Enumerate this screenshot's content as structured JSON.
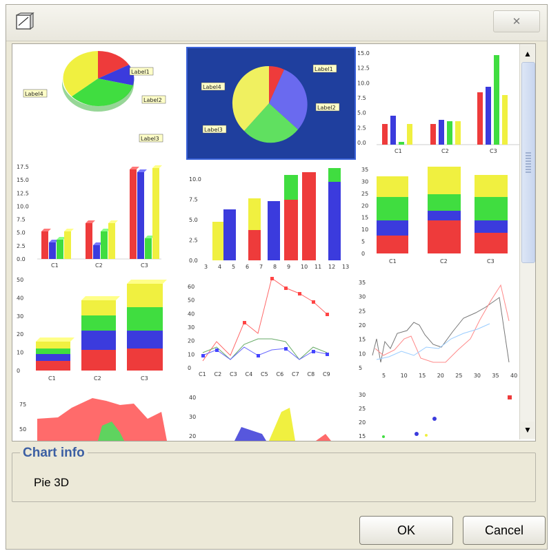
{
  "window": {
    "close_glyph": "✕"
  },
  "thumbnails": [
    {
      "name": "pie-chart-thumb",
      "labels": [
        "Label1",
        "Label2",
        "Label3",
        "Label4"
      ]
    },
    {
      "name": "pie-3d-chart-thumb",
      "labels": [
        "Label1",
        "Label2",
        "Label3",
        "Label4"
      ]
    },
    {
      "name": "bar-chart-thumb",
      "y_ticks": [
        "15.0",
        "12.5",
        "10.0",
        "7.5",
        "5.0",
        "2.5",
        "0.0"
      ],
      "x_ticks": [
        "C1",
        "C2",
        "C3"
      ]
    },
    {
      "name": "bar-3d-chart-thumb",
      "y_ticks": [
        "17.5",
        "15.0",
        "12.5",
        "10.0",
        "7.5",
        "5.0",
        "2.5",
        "0.0"
      ],
      "x_ticks": [
        "C1",
        "C2",
        "C3"
      ]
    },
    {
      "name": "xy-bar-chart-thumb",
      "y_ticks": [
        "10.0",
        "7.5",
        "5.0",
        "2.5",
        "0.0"
      ],
      "x_ticks": [
        "3",
        "4",
        "5",
        "6",
        "7",
        "8",
        "9",
        "10",
        "11",
        "12",
        "13"
      ]
    },
    {
      "name": "stacked-bar-chart-thumb",
      "y_ticks": [
        "35",
        "30",
        "25",
        "20",
        "15",
        "10",
        "5",
        "0"
      ],
      "x_ticks": [
        "C1",
        "C2",
        "C3"
      ]
    },
    {
      "name": "stacked-bar-3d-chart-thumb",
      "y_ticks": [
        "50",
        "40",
        "30",
        "20",
        "10",
        "0"
      ],
      "x_ticks": [
        "C1",
        "C2",
        "C3"
      ]
    },
    {
      "name": "line-chart-thumb",
      "y_ticks": [
        "60",
        "50",
        "40",
        "30",
        "20",
        "10",
        "0"
      ],
      "x_ticks": [
        "C1",
        "C2",
        "C3",
        "C4",
        "C5",
        "C6",
        "C7",
        "C8",
        "C9"
      ]
    },
    {
      "name": "xy-line-chart-thumb",
      "y_ticks": [
        "35",
        "30",
        "25",
        "20",
        "15",
        "10",
        "5"
      ],
      "x_ticks": [
        "5",
        "10",
        "15",
        "20",
        "25",
        "30",
        "35",
        "40"
      ]
    },
    {
      "name": "area-chart-thumb",
      "y_ticks": [
        "75",
        "50"
      ]
    },
    {
      "name": "stacked-area-chart-thumb",
      "y_ticks": [
        "40",
        "30",
        "20"
      ]
    },
    {
      "name": "scatter-chart-thumb",
      "y_ticks": [
        "30",
        "25",
        "20",
        "15"
      ]
    }
  ],
  "chart_info": {
    "title": "Chart info",
    "value": "Pie 3D"
  },
  "buttons": {
    "ok": "OK",
    "cancel": "Cancel"
  },
  "colors": {
    "red": "#ee3b3b",
    "blue": "#3b3bdd",
    "green": "#40dd40",
    "yellow": "#f0f040",
    "selection": "#1f3f9e"
  }
}
